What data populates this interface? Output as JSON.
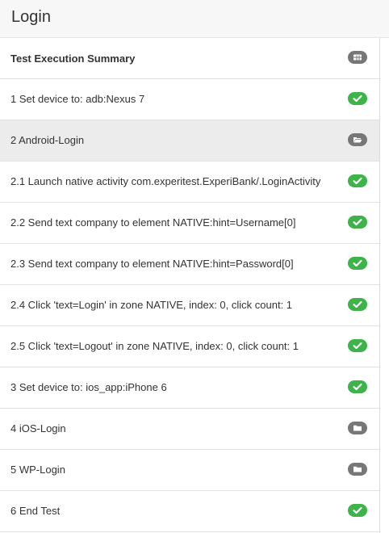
{
  "header": {
    "title": "Login"
  },
  "rows": [
    {
      "label": "Test Execution Summary",
      "icon": "table-icon",
      "status": "summary"
    },
    {
      "label": "1 Set device to: adb:Nexus 7",
      "icon": "check-icon",
      "status": "passed"
    },
    {
      "label": "2 Android-Login",
      "icon": "folder-open-icon",
      "status": "group"
    },
    {
      "label": "2.1 Launch native activity com.experitest.ExperiBank/.LoginActivity",
      "icon": "check-icon",
      "status": "passed"
    },
    {
      "label": "2.2 Send text company to element NATIVE:hint=Username[0]",
      "icon": "check-icon",
      "status": "passed"
    },
    {
      "label": "2.3 Send text company to element NATIVE:hint=Password[0]",
      "icon": "check-icon",
      "status": "passed"
    },
    {
      "label": "2.4 Click 'text=Login' in zone NATIVE, index: 0, click count: 1",
      "icon": "check-icon",
      "status": "passed"
    },
    {
      "label": "2.5 Click 'text=Logout' in zone NATIVE, index: 0, click count: 1",
      "icon": "check-icon",
      "status": "passed"
    },
    {
      "label": "3 Set device to: ios_app:iPhone 6",
      "icon": "check-icon",
      "status": "passed"
    },
    {
      "label": "4 iOS-Login",
      "icon": "folder-icon",
      "status": "group"
    },
    {
      "label": "5 WP-Login",
      "icon": "folder-icon",
      "status": "group"
    },
    {
      "label": "6 End Test",
      "icon": "check-icon",
      "status": "passed"
    }
  ],
  "selected_row": "2 Android-Login",
  "colors": {
    "pass": "#3db34a",
    "folder": "#777777",
    "selected_bg": "#ececec"
  }
}
